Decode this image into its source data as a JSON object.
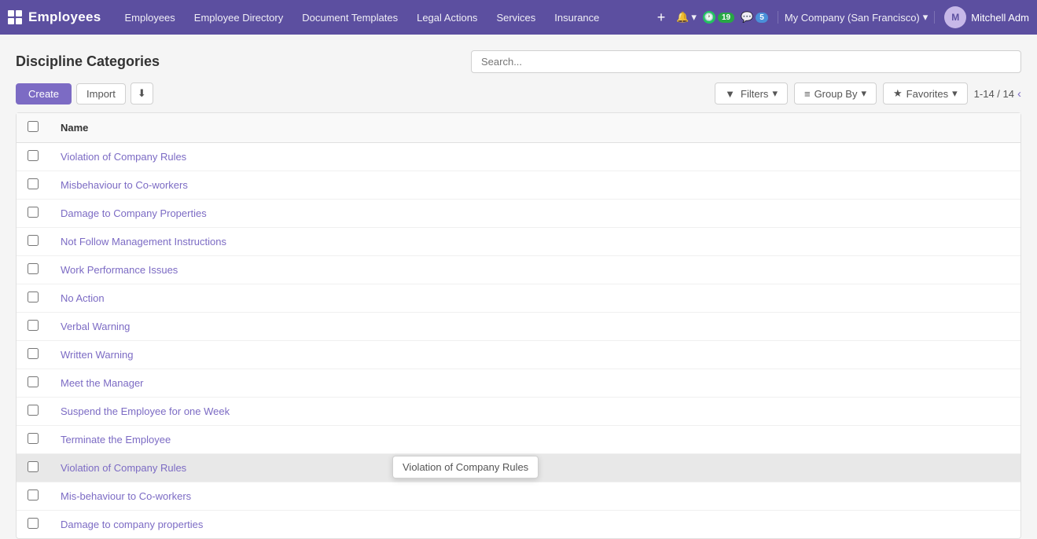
{
  "app": {
    "logo_title": "Employees",
    "logo_icon": "grid-icon"
  },
  "topnav": {
    "links": [
      {
        "label": "Employees",
        "key": "employees"
      },
      {
        "label": "Employee Directory",
        "key": "employee-directory"
      },
      {
        "label": "Document Templates",
        "key": "document-templates"
      },
      {
        "label": "Legal Actions",
        "key": "legal-actions"
      },
      {
        "label": "Services",
        "key": "services"
      },
      {
        "label": "Insurance",
        "key": "insurance"
      }
    ],
    "add_label": "+",
    "notification_count": "19",
    "message_count": "5",
    "company_name": "My Company (San Francisco)",
    "user_name": "Mitchell Adm"
  },
  "page": {
    "title": "Discipline Categories",
    "search_placeholder": "Search..."
  },
  "toolbar": {
    "create_label": "Create",
    "import_label": "Import",
    "filters_label": "Filters",
    "group_by_label": "Group By",
    "favorites_label": "Favorites",
    "pagination": "1-14 / 14"
  },
  "table": {
    "column_name": "Name",
    "rows": [
      {
        "id": 1,
        "name": "Violation of Company Rules"
      },
      {
        "id": 2,
        "name": "Misbehaviour to Co-workers"
      },
      {
        "id": 3,
        "name": "Damage to Company Properties"
      },
      {
        "id": 4,
        "name": "Not Follow Management Instructions"
      },
      {
        "id": 5,
        "name": "Work Performance Issues"
      },
      {
        "id": 6,
        "name": "No Action"
      },
      {
        "id": 7,
        "name": "Verbal Warning"
      },
      {
        "id": 8,
        "name": "Written Warning"
      },
      {
        "id": 9,
        "name": "Meet the Manager"
      },
      {
        "id": 10,
        "name": "Suspend the Employee for one Week"
      },
      {
        "id": 11,
        "name": "Terminate the Employee"
      },
      {
        "id": 12,
        "name": "Violation of Company Rules"
      },
      {
        "id": 13,
        "name": "Mis-behaviour to Co-workers"
      },
      {
        "id": 14,
        "name": "Damage to company properties"
      }
    ],
    "tooltip_row": 12,
    "tooltip_text": "Violation of Company Rules"
  }
}
